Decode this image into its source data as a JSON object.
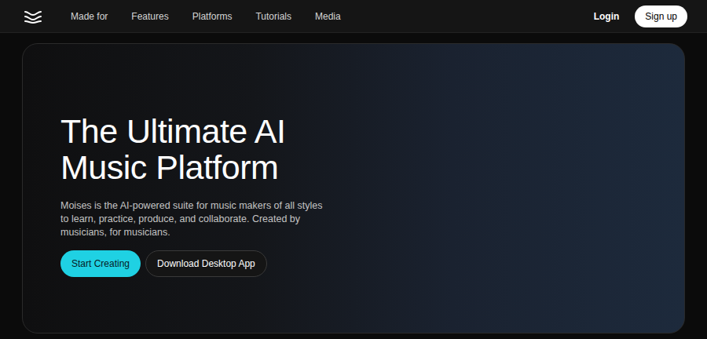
{
  "nav": {
    "items": [
      "Made for",
      "Features",
      "Platforms",
      "Tutorials",
      "Media"
    ],
    "login": "Login",
    "signup": "Sign up"
  },
  "hero": {
    "title_lines": [
      "The Ultimate AI",
      "Music Platform"
    ],
    "description": "Moises is the AI-powered suite for music makers of all styles to learn, practice, produce, and collaborate. Created by musicians, for musicians.",
    "primary_button": "Start Creating",
    "secondary_button": "Download Desktop App"
  }
}
